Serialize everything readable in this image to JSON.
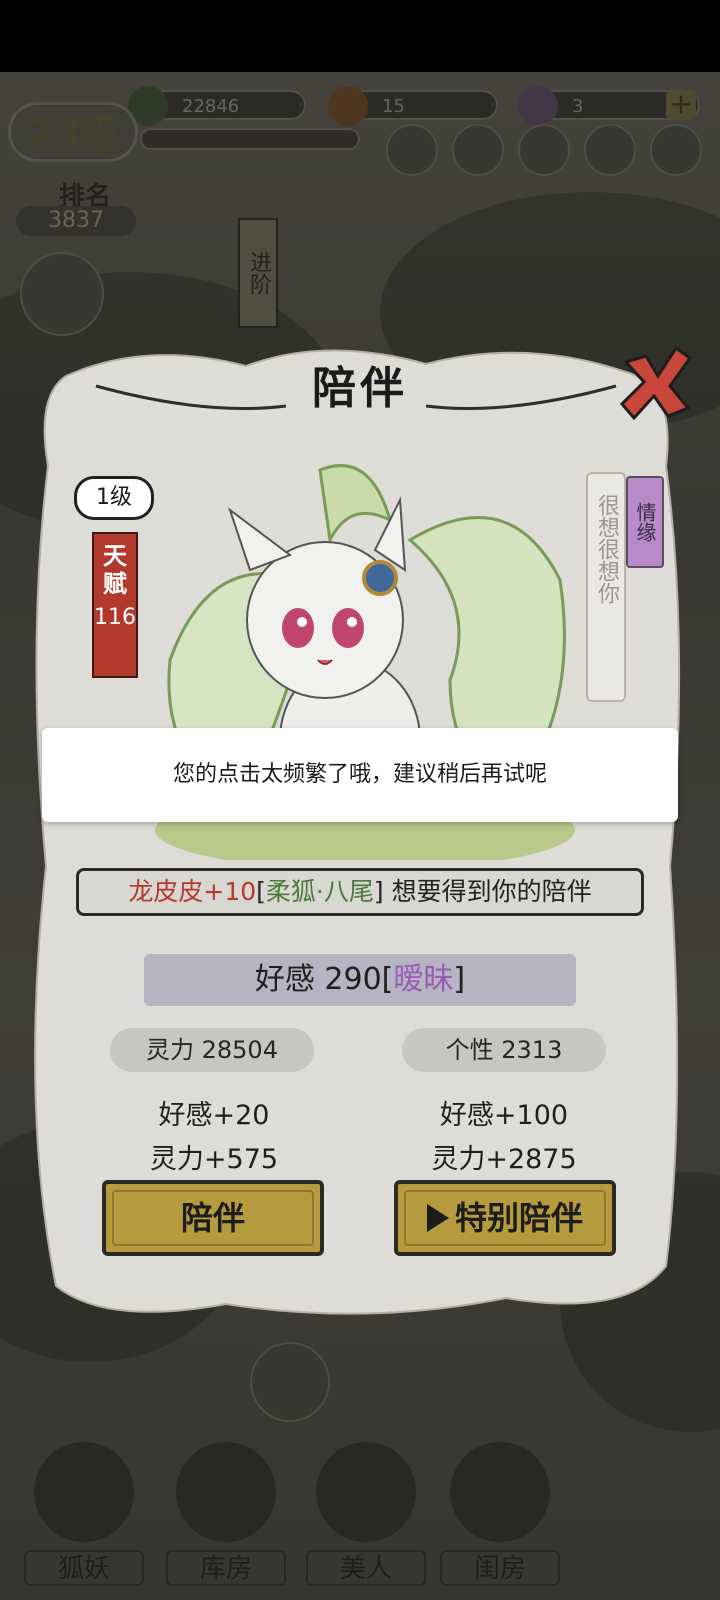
{
  "hud": {
    "resource_1": "22846",
    "resource_2": "15",
    "resource_3": "3",
    "plus_icon": "plus-icon",
    "level": "23级",
    "rank_label": "排名",
    "rank_value": "3837",
    "advance_button": "进阶"
  },
  "bottom_nav": [
    {
      "label": "狐妖"
    },
    {
      "label": "库房"
    },
    {
      "label": "美人"
    },
    {
      "label": "闺房"
    }
  ],
  "modal": {
    "title": "陪伴",
    "level_badge": "1级",
    "talent_label": "天赋",
    "talent_value": "116",
    "fate_tag": "情缘",
    "fate_text": "很想很想你",
    "message": {
      "bonus": "龙皮皮+10",
      "name_open": "[",
      "name": "柔狐·八尾",
      "name_close": "]",
      "text": " 想要得到你的陪伴"
    },
    "affection_label": "好感 290[",
    "affection_status": "暧昧",
    "affection_close": "]",
    "spirit_stat": "灵力 28504",
    "personality_stat": "个性 2313",
    "left_bonus_affection": "好感+20",
    "left_bonus_spirit": "灵力+575",
    "right_bonus_affection": "好感+100",
    "right_bonus_spirit": "灵力+2875",
    "accompany_button": "陪伴",
    "special_button": "特别陪伴"
  },
  "toast": {
    "text": "您的点击太频繁了哦，建议稍后再试呢"
  },
  "colors": {
    "talent_red": "#b2392b",
    "button_gold": "#b69a3e",
    "affection_purple": "#9a5bb6",
    "bonus_red": "#b33a2d",
    "name_green": "#4a7a3a"
  }
}
